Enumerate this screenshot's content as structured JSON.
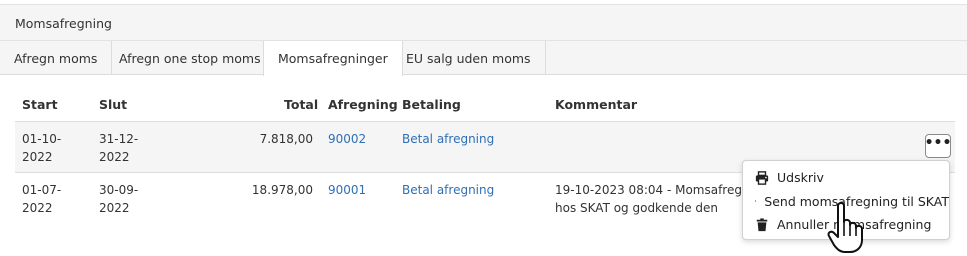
{
  "panel": {
    "title": "Momsafregning"
  },
  "tabs": [
    {
      "label": "Afregn moms"
    },
    {
      "label": "Afregn one stop moms"
    },
    {
      "label": "Momsafregninger",
      "active": true
    },
    {
      "label": "EU salg uden moms"
    }
  ],
  "table": {
    "columns": [
      "Start",
      "Slut",
      "Total",
      "Afregning",
      "Betaling",
      "Kommentar"
    ],
    "rows": [
      {
        "start_l1": "01-10-",
        "start_l2": "2022",
        "slut_l1": "31-12-",
        "slut_l2": "2022",
        "total": "7.818,00",
        "afregning": "90002",
        "betaling": "Betal afregning",
        "kommentar_l1": "",
        "kommentar_l2": ""
      },
      {
        "start_l1": "01-07-",
        "start_l2": "2022",
        "slut_l1": "30-09-",
        "slut_l2": "2022",
        "total": "18.978,00",
        "afregning": "90001",
        "betaling": "Betal afregning",
        "kommentar_l1": "19-10-2023 08:04 - Momsafregnin",
        "kommentar_l2": "hos SKAT og godkende den"
      }
    ]
  },
  "actions_button": {
    "label": "•••"
  },
  "dropdown": {
    "items": [
      {
        "label": "Udskriv",
        "icon": "printer-icon"
      },
      {
        "label": "Send momsafregning til SKAT",
        "icon": "file-export-icon"
      },
      {
        "label": "Annuller momsafregning",
        "icon": "trash-icon"
      }
    ]
  }
}
